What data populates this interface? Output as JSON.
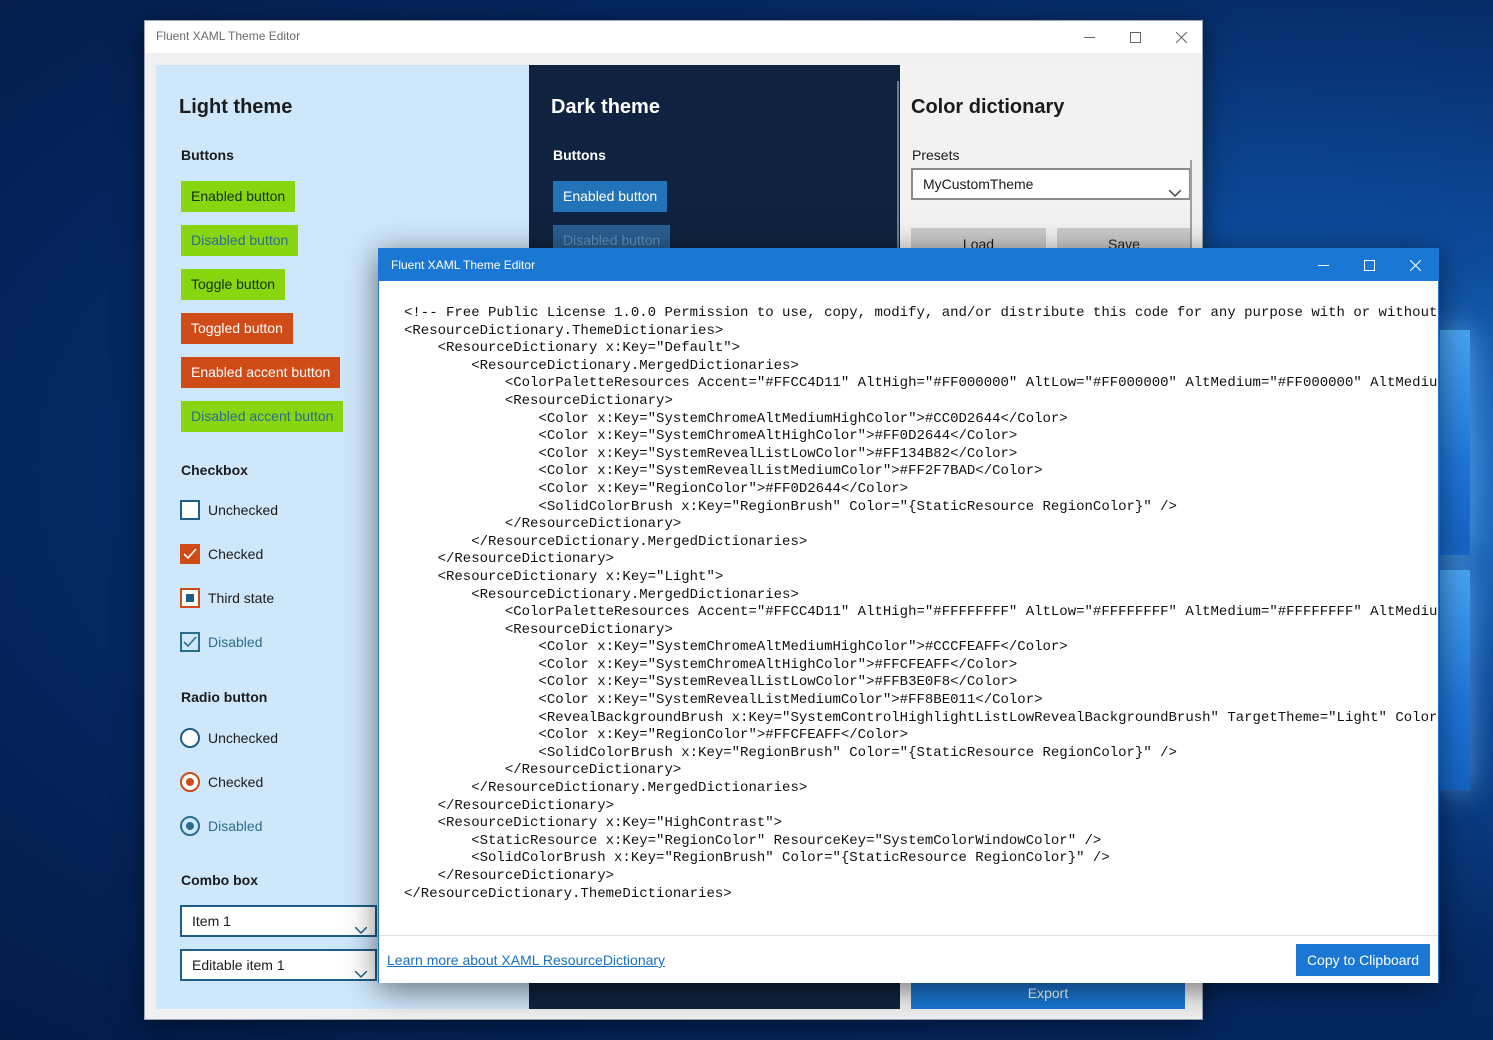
{
  "main_window": {
    "title": "Fluent XAML Theme Editor",
    "light": {
      "title": "Light theme",
      "buttons_title": "Buttons",
      "buttons": [
        "Enabled button",
        "Disabled button",
        "Toggle button",
        "Toggled button",
        "Enabled accent button",
        "Disabled accent button"
      ],
      "checkbox_title": "Checkbox",
      "checkboxes": [
        "Unchecked",
        "Checked",
        "Third state",
        "Disabled"
      ],
      "radio_title": "Radio button",
      "radios": [
        "Unchecked",
        "Checked",
        "Disabled"
      ],
      "combo_title": "Combo box",
      "combo_value": "Item 1",
      "editable_combo_value": "Editable item 1"
    },
    "dark": {
      "title": "Dark theme",
      "buttons_title": "Buttons",
      "buttons": [
        "Enabled button",
        "Disabled button"
      ]
    },
    "dict": {
      "title": "Color dictionary",
      "presets_label": "Presets",
      "preset_value": "MyCustomTheme",
      "load_label": "Load",
      "save_label": "Save",
      "export_label": "Export"
    }
  },
  "dialog": {
    "title": "Fluent XAML Theme Editor",
    "code": "<!-- Free Public License 1.0.0 Permission to use, copy, modify, and/or distribute this code for any purpose with or without fe\n<ResourceDictionary.ThemeDictionaries>\n    <ResourceDictionary x:Key=\"Default\">\n        <ResourceDictionary.MergedDictionaries>\n            <ColorPaletteResources Accent=\"#FFCC4D11\" AltHigh=\"#FF000000\" AltLow=\"#FF000000\" AltMedium=\"#FF000000\" AltMediumHi\n            <ResourceDictionary>\n                <Color x:Key=\"SystemChromeAltMediumHighColor\">#CC0D2644</Color>\n                <Color x:Key=\"SystemChromeAltHighColor\">#FF0D2644</Color>\n                <Color x:Key=\"SystemRevealListLowColor\">#FF134B82</Color>\n                <Color x:Key=\"SystemRevealListMediumColor\">#FF2F7BAD</Color>\n                <Color x:Key=\"RegionColor\">#FF0D2644</Color>\n                <SolidColorBrush x:Key=\"RegionBrush\" Color=\"{StaticResource RegionColor}\" />\n            </ResourceDictionary>\n        </ResourceDictionary.MergedDictionaries>\n    </ResourceDictionary>\n    <ResourceDictionary x:Key=\"Light\">\n        <ResourceDictionary.MergedDictionaries>\n            <ColorPaletteResources Accent=\"#FFCC4D11\" AltHigh=\"#FFFFFFFF\" AltLow=\"#FFFFFFFF\" AltMedium=\"#FFFFFFFF\" AltMediumHi\n            <ResourceDictionary>\n                <Color x:Key=\"SystemChromeAltMediumHighColor\">#CCCFEAFF</Color>\n                <Color x:Key=\"SystemChromeAltHighColor\">#FFCFEAFF</Color>\n                <Color x:Key=\"SystemRevealListLowColor\">#FFB3E0F8</Color>\n                <Color x:Key=\"SystemRevealListMediumColor\">#FF8BE011</Color>\n                <RevealBackgroundBrush x:Key=\"SystemControlHighlightListLowRevealBackgroundBrush\" TargetTheme=\"Light\" Color=\"#\n                <Color x:Key=\"RegionColor\">#FFCFEAFF</Color>\n                <SolidColorBrush x:Key=\"RegionBrush\" Color=\"{StaticResource RegionColor}\" />\n            </ResourceDictionary>\n        </ResourceDictionary.MergedDictionaries>\n    </ResourceDictionary>\n    <ResourceDictionary x:Key=\"HighContrast\">\n        <StaticResource x:Key=\"RegionColor\" ResourceKey=\"SystemColorWindowColor\" />\n        <SolidColorBrush x:Key=\"RegionBrush\" Color=\"{StaticResource RegionColor}\" />\n    </ResourceDictionary>\n</ResourceDictionary.ThemeDictionaries>",
    "link_label": "Learn more about XAML ResourceDictionary",
    "copy_label": "Copy to Clipboard"
  },
  "colors": {
    "light_panel": "#cfe7fb",
    "dark_panel": "#0f2340",
    "green": "#89d610",
    "orange": "#cf4b17",
    "accent_blue": "#1a78d4"
  },
  "icons": [
    "minimize-icon",
    "maximize-icon",
    "close-icon",
    "chevron-down-icon",
    "checkmark-icon"
  ]
}
